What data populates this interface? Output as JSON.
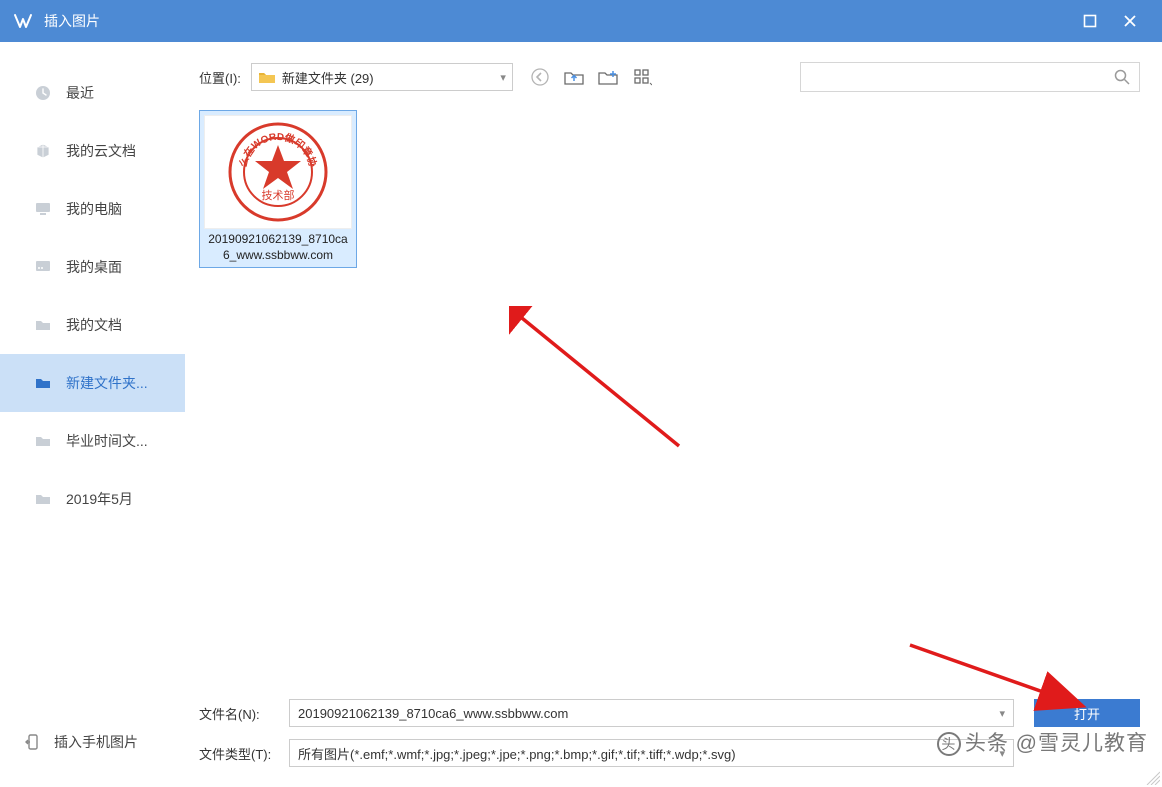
{
  "titlebar": {
    "title": "插入图片"
  },
  "sidebar": {
    "items": [
      {
        "label": "最近",
        "icon": "clock"
      },
      {
        "label": "我的云文档",
        "icon": "cube"
      },
      {
        "label": "我的电脑",
        "icon": "monitor"
      },
      {
        "label": "我的桌面",
        "icon": "desktop"
      },
      {
        "label": "我的文档",
        "icon": "folder"
      },
      {
        "label": "新建文件夹...",
        "icon": "folder",
        "selected": true
      },
      {
        "label": "毕业时间文...",
        "icon": "folder"
      },
      {
        "label": "2019年5月",
        "icon": "folder"
      }
    ],
    "insert_phone": "插入手机图片"
  },
  "toolbar": {
    "location_label": "位置(I):",
    "path": "新建文件夹 (29)",
    "search_placeholder": ""
  },
  "files": [
    {
      "name": "20190921062139_8710ca6_www.ssbbww.com",
      "stamp_top": "WORD",
      "stamp_bottom": "技术部"
    }
  ],
  "bottom": {
    "filename_label": "文件名(N):",
    "filename_value": "20190921062139_8710ca6_www.ssbbww.com",
    "filetype_label": "文件类型(T):",
    "filetype_value": "所有图片(*.emf;*.wmf;*.jpg;*.jpeg;*.jpe;*.png;*.bmp;*.gif;*.tif;*.tiff;*.wdp;*.svg)",
    "open_button": "打开"
  },
  "watermark": "头条 @雪灵儿教育"
}
